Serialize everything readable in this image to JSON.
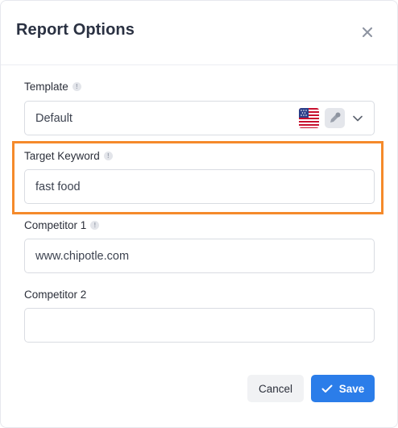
{
  "dialog": {
    "title": "Report Options"
  },
  "template": {
    "label": "Template",
    "value": "Default",
    "icons": [
      "info-icon",
      "us-flag-icon",
      "edit-icon",
      "chevron-down-icon"
    ]
  },
  "target_keyword": {
    "label": "Target Keyword",
    "value": "fast food",
    "highlighted": true,
    "highlight_color": "#f58a2b"
  },
  "competitor_1": {
    "label": "Competitor 1",
    "value": "www.chipotle.com"
  },
  "competitor_2": {
    "label": "Competitor 2",
    "value": ""
  },
  "buttons": {
    "cancel": "Cancel",
    "save": "Save"
  },
  "colors": {
    "primary": "#2b7de9",
    "highlight": "#f58a2b"
  }
}
